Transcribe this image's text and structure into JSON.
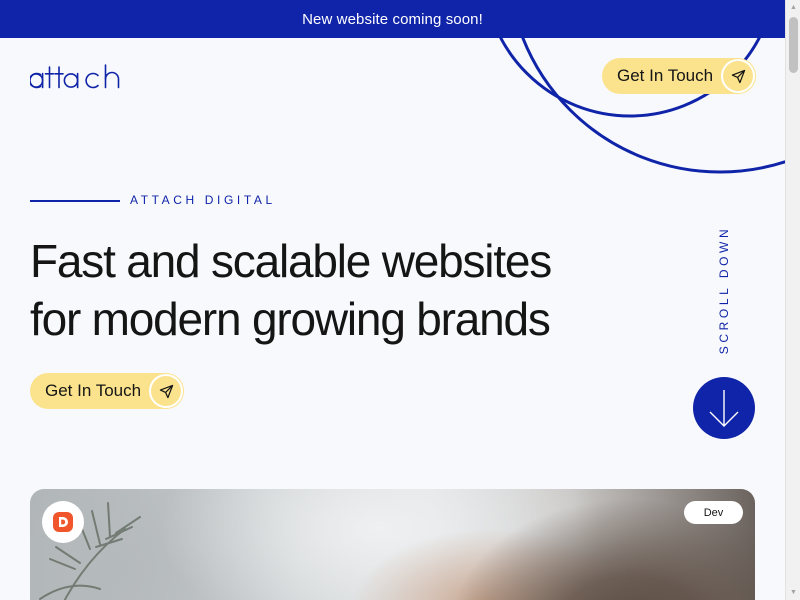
{
  "announcement": {
    "text": "New website coming soon!"
  },
  "header": {
    "logo_text": "attach",
    "cta_label": "Get In Touch"
  },
  "hero": {
    "eyebrow": "ATTACH DIGITAL",
    "headline_line1": "Fast and scalable websites",
    "headline_line2": "for modern growing brands",
    "cta_label": "Get In Touch",
    "scroll_label": "SCROLL DOWN"
  },
  "card": {
    "tag": "Dev"
  },
  "colors": {
    "brand_blue": "#0f24a8",
    "cta_yellow": "#fbe38d",
    "background": "#f8f9fc",
    "text": "#151515"
  },
  "icons": {
    "cta_icon": "send-icon",
    "scroll_icon": "arrow-down-icon",
    "brand_icon": "d-logo-icon"
  }
}
